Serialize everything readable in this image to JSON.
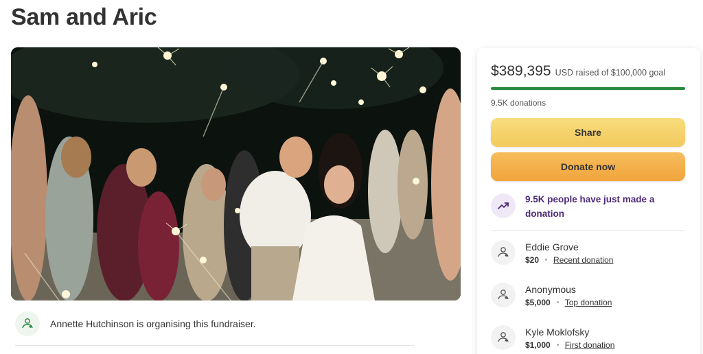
{
  "page": {
    "title": "Sam and Aric"
  },
  "hero": {
    "alt": "Couple walking through sparkler send-off"
  },
  "organiser": {
    "text": "Annette Hutchinson is organising this fundraiser."
  },
  "donation_card": {
    "amount_raised": "$389,395",
    "goal_text": "USD raised of $100,000 goal",
    "progress_fraction": 1.0,
    "donation_count": "9.5K donations",
    "share_label": "Share",
    "donate_label": "Donate now",
    "trend_text": "9.5K people have just made a donation",
    "donors": [
      {
        "name": "Eddie Grove",
        "amount": "$20",
        "tag": "Recent donation"
      },
      {
        "name": "Anonymous",
        "amount": "$5,000",
        "tag": "Top donation"
      },
      {
        "name": "Kyle Moklofsky",
        "amount": "$1,000",
        "tag": "First donation"
      }
    ]
  },
  "colors": {
    "progress": "#2b8a3e",
    "share": "#f2c95c",
    "donate": "#f1a43c",
    "trend": "#4b2a7a"
  },
  "icons": {
    "organiser": "heart-hand-icon",
    "trend": "trending-up-icon",
    "donor": "heart-hand-icon"
  }
}
